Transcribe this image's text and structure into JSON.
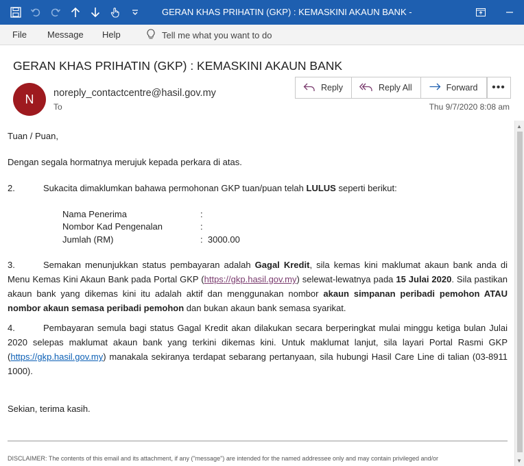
{
  "window": {
    "title": "GERAN KHAS PRIHATIN (GKP) : KEMASKINI AKAUN BANK  -",
    "colors": {
      "titlebar": "#1e5fb0",
      "avatar": "#9e1a1f",
      "link": "#0b5fb5"
    }
  },
  "ribbon": {
    "tabs": [
      "File",
      "Message",
      "Help"
    ],
    "tell_me": "Tell me what you want to do"
  },
  "header": {
    "subject": "GERAN KHAS PRIHATIN (GKP) : KEMASKINI AKAUN BANK",
    "avatar_initial": "N",
    "sender": "noreply_contactcentre@hasil.gov.my",
    "to_label": "To",
    "datetime": "Thu 9/7/2020 8:08 am",
    "actions": {
      "reply": "Reply",
      "reply_all": "Reply All",
      "forward": "Forward",
      "more": "•••"
    }
  },
  "body": {
    "greeting": "Tuan / Puan,",
    "intro": "Dengan segala hormatnya merujuk kepada perkara di atas.",
    "p2": {
      "num": "2.",
      "text_a": "Sukacita dimaklumkan bahawa permohonan GKP tuan/puan telah ",
      "bold": "LULUS",
      "text_b": " seperti berikut:"
    },
    "fields": [
      {
        "label": "Nama Penerima",
        "colon": ":",
        "value": ""
      },
      {
        "label": "Nombor Kad Pengenalan",
        "colon": ":",
        "value": ""
      },
      {
        "label": "Jumlah (RM)",
        "colon": ":",
        "value": "3000.00"
      }
    ],
    "p3": {
      "num": "3.",
      "t1": "Semakan menunjukkan status pembayaran adalah ",
      "b1": "Gagal Kredit",
      "t2": ", sila kemas kini maklumat akaun bank anda di Menu Kemas Kini Akaun Bank pada Portal GKP (",
      "link": "https://gkp.hasil.gov.my",
      "t3": ") selewat-lewatnya pada ",
      "b2": "15 Julai 2020",
      "t4": ". Sila pastikan akaun bank yang dikemas kini itu adalah aktif dan menggunakan nombor ",
      "b3": "akaun simpanan peribadi pemohon ATAU nombor akaun semasa peribadi pemohon",
      "t5": " dan bukan akaun bank semasa syarikat."
    },
    "p4": {
      "num": "4.",
      "t1": "Pembayaran semula bagi status Gagal Kredit akan dilakukan secara berperingkat mulai minggu ketiga bulan Julai 2020 selepas maklumat akaun bank yang terkini dikemas kini. Untuk maklumat lanjut, sila layari Portal Rasmi GKP (",
      "link": "https://gkp.hasil.gov.my",
      "t2": ") manakala sekiranya terdapat sebarang pertanyaan, sila hubungi Hasil Care Line di talian (03-8911 1000)."
    },
    "closing": "Sekian, terima kasih.",
    "disclaimer": "DISCLAIMER: The contents of this email and its attachment, if any (\"message\") are intended for the named addressee only and may contain privileged and/or"
  }
}
